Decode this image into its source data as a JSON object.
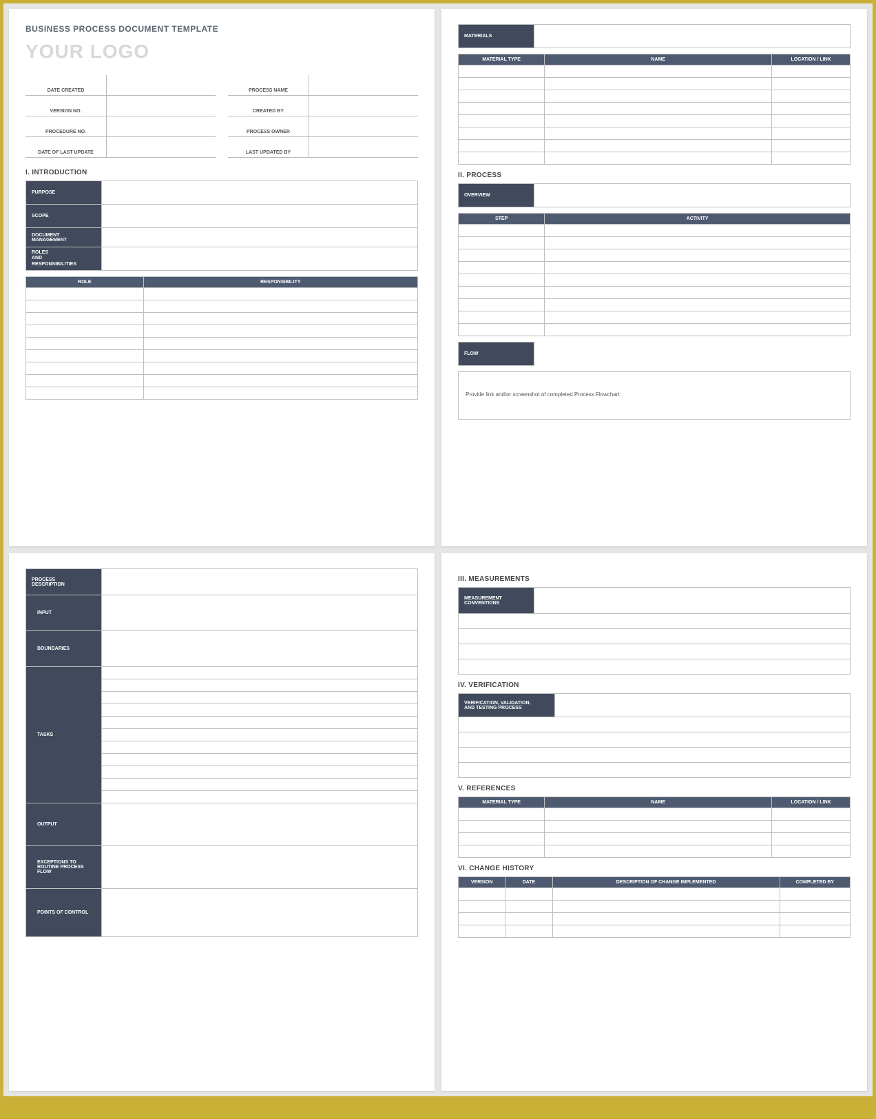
{
  "header": {
    "doc_title": "BUSINESS PROCESS DOCUMENT TEMPLATE",
    "logo_text": "YOUR LOGO"
  },
  "meta": {
    "date_created": "DATE CREATED",
    "process_name": "PROCESS NAME",
    "version_no": "VERSION NO.",
    "created_by": "CREATED BY",
    "procedure_no": "PROCEDURE NO.",
    "process_owner": "PROCESS OWNER",
    "date_last_update": "DATE OF LAST UPDATE",
    "last_updated_by": "LAST UPDATED BY"
  },
  "sections": {
    "introduction": {
      "heading": "I.   INTRODUCTION",
      "purpose": "PURPOSE",
      "scope": "SCOPE",
      "doc_mgmt": "DOCUMENT MANAGEMENT",
      "roles_resp": "ROLES\nAND\nRESPONSIBILITIES",
      "role_col": "ROLE",
      "responsibility_col": "RESPONSIBILITY"
    },
    "materials": {
      "label": "MATERIALS",
      "cols": {
        "type": "MATERIAL TYPE",
        "name": "NAME",
        "loc": "LOCATION / LINK"
      }
    },
    "process": {
      "heading": "II.  PROCESS",
      "overview": "OVERVIEW",
      "step_col": "STEP",
      "activity_col": "ACTIVITY",
      "flow": "FLOW",
      "flow_note": "Provide link and/or screenshot of completed Process Flowchart"
    },
    "process_desc": {
      "label": "PROCESS\nDESCRIPTION",
      "input": "INPUT",
      "boundaries": "BOUNDARIES",
      "tasks": "TASKS",
      "output": "OUTPUT",
      "exceptions": "EXCEPTIONS TO\nROUTINE PROCESS FLOW",
      "points": "POINTS OF CONTROL"
    },
    "measurements": {
      "heading": "III. MEASUREMENTS",
      "conventions": "MEASUREMENT\nCONVENTIONS"
    },
    "verification": {
      "heading": "IV. VERIFICATION",
      "label": "VERIFICATION, VALIDATION,\nAND TESTING PROCESS"
    },
    "references": {
      "heading": "V.  REFERENCES",
      "cols": {
        "type": "MATERIAL TYPE",
        "name": "NAME",
        "loc": "LOCATION / LINK"
      }
    },
    "change_history": {
      "heading": "VI. CHANGE HISTORY",
      "cols": {
        "version": "VERSION",
        "date": "DATE",
        "desc": "DESCRIPTION OF CHANGE IMPLEMENTED",
        "by": "COMPLETED BY"
      }
    }
  }
}
